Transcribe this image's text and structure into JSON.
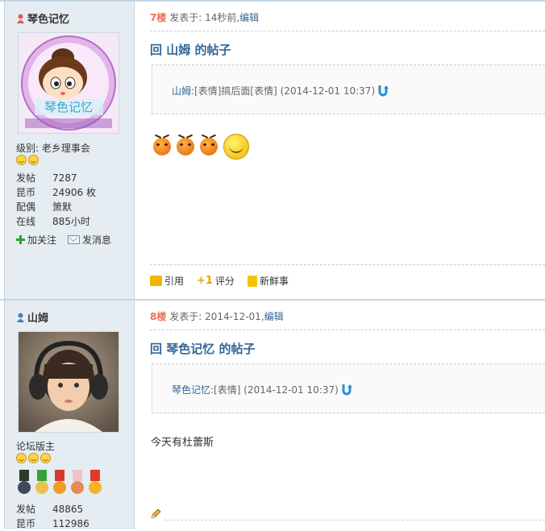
{
  "posts": [
    {
      "floor": "7楼",
      "posted_label": "发表于:",
      "posted_time": "14秒前",
      "separator": ",",
      "edit_label": "编辑",
      "title": "回 山姆 的帖子",
      "quote_author": "山姆",
      "quote_body": ":[表情]搞后面[表情]",
      "quote_time": "(2014-12-01 10:37)",
      "emotes": [
        "angry-face-icon",
        "angry-face-icon",
        "angry-face-icon",
        "laughing-face-icon"
      ],
      "toolbar": {
        "quote": "引用",
        "rate": "评分",
        "news": "新鲜事"
      },
      "user": {
        "name": "琴色记忆",
        "avatar_text": "琴色记忆",
        "rank": "级别: 老乡理事会",
        "stats": [
          {
            "k": "发帖",
            "v": "7287"
          },
          {
            "k": "昆币",
            "v": "24906 枚"
          },
          {
            "k": "配偶",
            "v": "箫默"
          },
          {
            "k": "在线",
            "v": "885小时"
          }
        ],
        "follow": "加关注",
        "message": "发消息"
      }
    },
    {
      "floor": "8楼",
      "posted_label": "发表于:",
      "posted_time": "2014-12-01",
      "separator": ",",
      "edit_label": "编辑",
      "title": "回 琴色记忆 的帖子",
      "quote_author": "琴色记忆",
      "quote_body": ":[表情]",
      "quote_time": "(2014-12-01 10:37)",
      "content": "今天有杜蕾斯",
      "user": {
        "name": "山姆",
        "rank": "论坛版主",
        "stats": [
          {
            "k": "发帖",
            "v": "48865"
          },
          {
            "k": "昆币",
            "v": "112986"
          }
        ]
      }
    }
  ],
  "colors": {
    "link": "#336699",
    "floor": "#f26c4f",
    "sidebar": "#e5edf2"
  }
}
